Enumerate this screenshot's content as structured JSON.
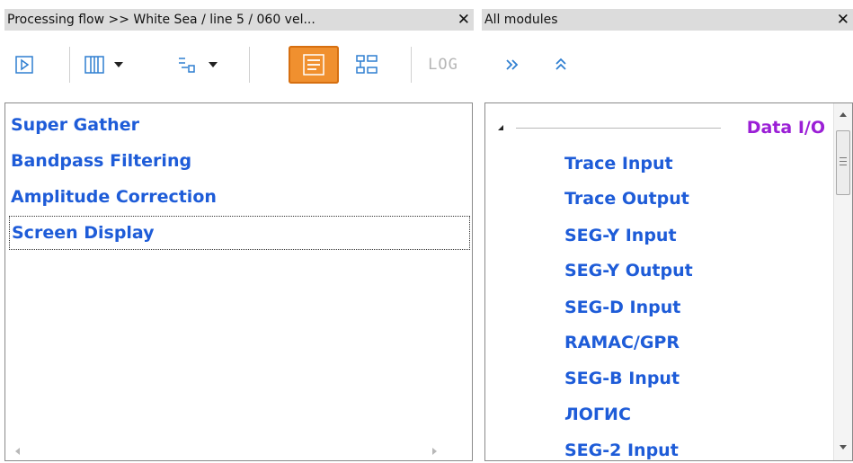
{
  "left_panel": {
    "title": "Processing flow >> White Sea / line 5 / 060 vel...",
    "close_label": "✕",
    "toolbar": {
      "run_icon": "play-icon",
      "display_icon": "columns-icon",
      "sort_icon": "list-sort-icon",
      "list_view_icon": "list-view-icon",
      "tree_view_icon": "tree-view-icon",
      "log_label": "LOG",
      "active_color": "#f0902f"
    },
    "flow_items": [
      {
        "label": "Super Gather"
      },
      {
        "label": "Bandpass Filtering"
      },
      {
        "label": "Amplitude Correction"
      },
      {
        "label": "Screen Display"
      }
    ]
  },
  "right_panel": {
    "title": "All modules",
    "close_label": "✕",
    "toolbar": {
      "expand_icon": "double-chevron-right-icon",
      "collapse_icon": "double-chevron-up-icon"
    },
    "group": {
      "label": "Data I/O",
      "color": "#9b1fd6"
    },
    "modules": [
      "Trace Input",
      "Trace Output",
      "SEG-Y Input",
      "SEG-Y Output",
      "SEG-D Input",
      "RAMAC/GPR",
      "SEG-B Input",
      "ЛОГИС",
      "SEG-2 Input"
    ]
  },
  "colors": {
    "item_blue": "#1e5cd8",
    "icon_blue": "#2f7fd1",
    "titlebar_bg": "#dcdcdc"
  }
}
